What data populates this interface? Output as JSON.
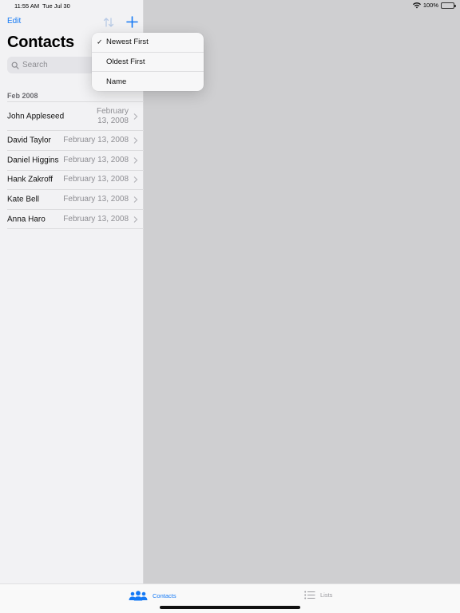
{
  "status_bar": {
    "time": "11:55 AM",
    "date": "Tue Jul 30",
    "battery": "100%"
  },
  "sidebar": {
    "edit_label": "Edit",
    "title": "Contacts",
    "search_placeholder": "Search",
    "section_header": "Feb 2008",
    "contacts": [
      {
        "name": "John Appleseed",
        "date": "February 13, 2008"
      },
      {
        "name": "David Taylor",
        "date": "February 13, 2008"
      },
      {
        "name": "Daniel Higgins",
        "date": "February 13, 2008"
      },
      {
        "name": "Hank Zakroff",
        "date": "February 13, 2008"
      },
      {
        "name": "Kate Bell",
        "date": "February 13, 2008"
      },
      {
        "name": "Anna Haro",
        "date": "February 13, 2008"
      }
    ]
  },
  "sort_menu": {
    "items": [
      {
        "label": "Newest First",
        "checked": true
      },
      {
        "label": "Oldest First",
        "checked": false
      },
      {
        "label": "Name",
        "checked": false
      }
    ],
    "check_glyph": "✓"
  },
  "tab_bar": {
    "tabs": [
      {
        "label": "Contacts",
        "icon": "people-icon",
        "active": true
      },
      {
        "label": "Lists",
        "icon": "list-icon",
        "active": false
      }
    ]
  },
  "colors": {
    "accent": "#1479f5",
    "sidebar_bg": "#f2f2f4",
    "detail_bg": "#cfcfd1"
  }
}
